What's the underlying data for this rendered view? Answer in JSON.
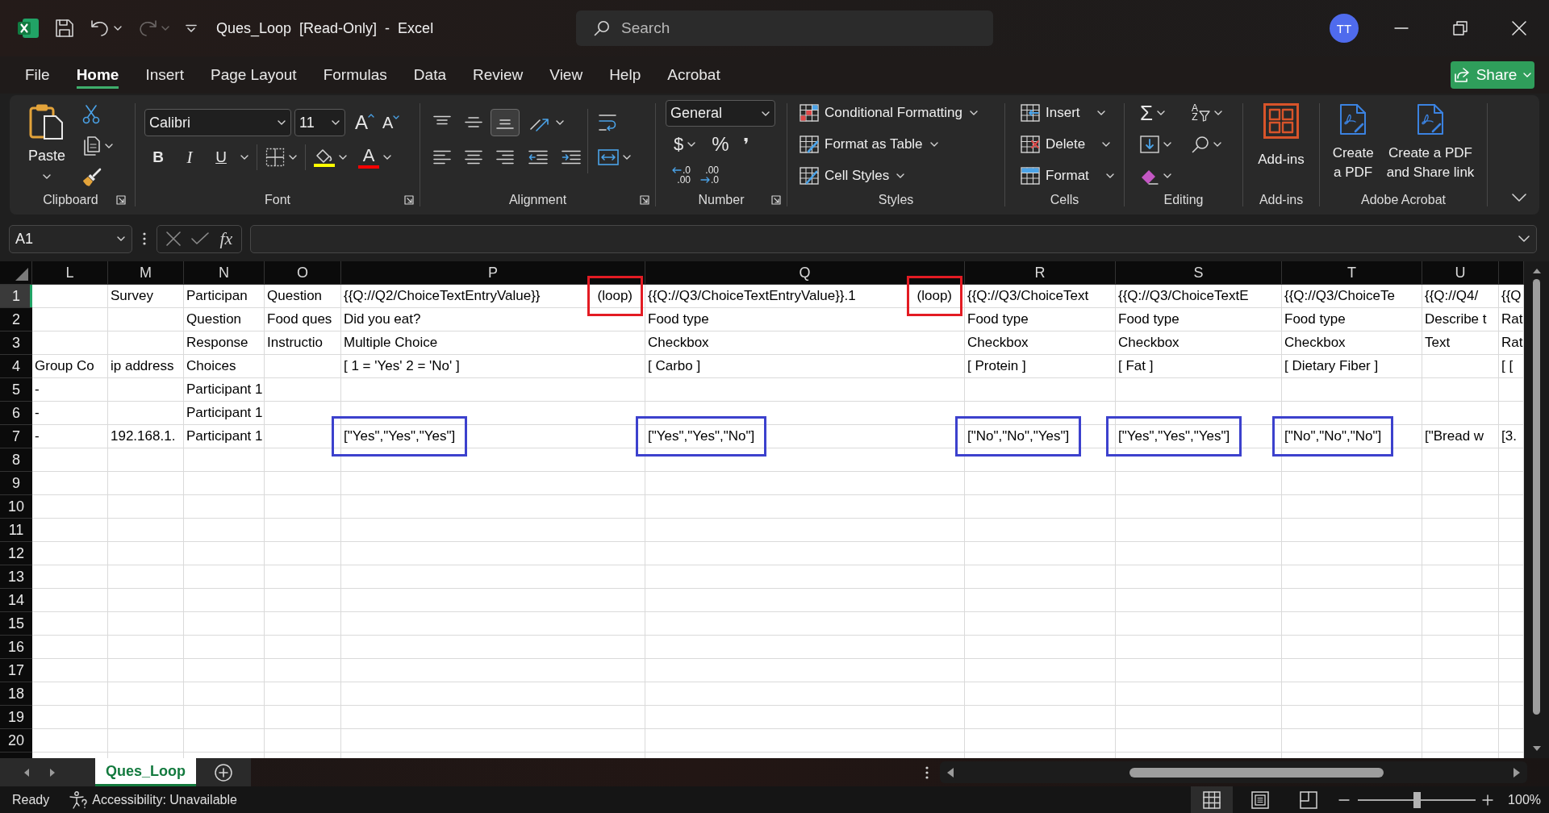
{
  "window": {
    "title": "Ques_Loop [Read-Only] - Excel",
    "search": {
      "placeholder": "Search"
    },
    "account": {
      "initials": "TT"
    }
  },
  "quick_access": [
    {
      "kind": "save",
      "disabled": false,
      "dropdown": false
    },
    {
      "kind": "undo",
      "disabled": false,
      "dropdown": true
    },
    {
      "kind": "redo",
      "disabled": true,
      "dropdown": true
    },
    {
      "kind": "customize",
      "disabled": false,
      "dropdown": false
    }
  ],
  "menu_tabs": [
    {
      "label": "File",
      "selected": false
    },
    {
      "label": "Home",
      "selected": true
    },
    {
      "label": "Insert",
      "selected": false
    },
    {
      "label": "Page Layout",
      "selected": false
    },
    {
      "label": "Formulas",
      "selected": false
    },
    {
      "label": "Data",
      "selected": false
    },
    {
      "label": "Review",
      "selected": false
    },
    {
      "label": "View",
      "selected": false
    },
    {
      "label": "Help",
      "selected": false
    },
    {
      "label": "Acrobat",
      "selected": false
    }
  ],
  "share_button": {
    "label": "Share"
  },
  "ribbon": {
    "clipboard": {
      "label": "Clipboard",
      "paste": "Paste"
    },
    "font": {
      "label": "Font",
      "face": "Calibri",
      "size": "11",
      "grow": "A",
      "shrink": "A",
      "bold": "B",
      "italic": "I",
      "underline": "U",
      "font_color": "A"
    },
    "alignment": {
      "label": "Alignment",
      "vertical": [
        {
          "kind": "top",
          "selected": false
        },
        {
          "kind": "middle",
          "selected": false
        },
        {
          "kind": "bottom",
          "selected": true
        }
      ],
      "horizontal": [
        {
          "kind": "left",
          "selected": false
        },
        {
          "kind": "center",
          "selected": false
        },
        {
          "kind": "right",
          "selected": false
        }
      ]
    },
    "number": {
      "label": "Number",
      "format": "General",
      "currency": "$",
      "percent": "%",
      "comma": "❜",
      "decimals": [
        {
          "kind": "increase",
          "top": ".0",
          "bottom": ".00"
        },
        {
          "kind": "decrease",
          "top": ".00",
          "bottom": ".0"
        }
      ]
    },
    "styles": {
      "label": "Styles",
      "items": [
        {
          "kind": "conditional",
          "label": "Conditional Formatting"
        },
        {
          "kind": "table",
          "label": "Format as Table"
        },
        {
          "kind": "cell_styles",
          "label": "Cell Styles"
        }
      ]
    },
    "cells": {
      "label": "Cells",
      "items": [
        {
          "kind": "insert",
          "label": "Insert"
        },
        {
          "kind": "delete",
          "label": "Delete"
        },
        {
          "kind": "format",
          "label": "Format"
        }
      ]
    },
    "editing": {
      "label": "Editing",
      "sum": "Σ",
      "sort": [
        "A",
        "Z"
      ]
    },
    "addins": {
      "label": "Add-ins",
      "button": "Add-ins"
    },
    "acrobat": {
      "label": "Adobe Acrobat",
      "buttons": [
        "Create\na PDF",
        "Create a PDF\nand Share link"
      ]
    }
  },
  "formula_bar": {
    "name_box": "A1",
    "function_button": "fx"
  },
  "sheet": {
    "columns": [
      "L",
      "M",
      "N",
      "O",
      "P",
      "Q",
      "R",
      "S",
      "T",
      "U"
    ],
    "rows": [
      {
        "number": "1",
        "selected": true,
        "cells": [
          null,
          "Survey",
          "Participan",
          "Question",
          {
            "text": "{{Q://Q2/ChoiceTextEntryValue}}",
            "tag": {
              "text": "(loop)",
              "color": "#e31b23"
            }
          },
          {
            "text": "{{Q://Q3/ChoiceTextEntryValue}}.1",
            "tag": {
              "text": "(loop)",
              "color": "#e31b23"
            }
          },
          "{{Q://Q3/ChoiceText",
          "{{Q://Q3/ChoiceTextE",
          "{{Q://Q3/ChoiceTe",
          "{{Q://Q4/",
          "{{Q"
        ]
      },
      {
        "number": "2",
        "selected": false,
        "cells": [
          null,
          null,
          "Question",
          "Food ques",
          "Did you eat?",
          "Food type",
          "Food type",
          "Food type",
          "Food type",
          "Describe t",
          "Rat"
        ]
      },
      {
        "number": "3",
        "selected": false,
        "cells": [
          null,
          null,
          "Response",
          "Instructio",
          "Multiple Choice",
          "Checkbox",
          "Checkbox",
          "Checkbox",
          "Checkbox",
          "Text",
          "Rat"
        ]
      },
      {
        "number": "4",
        "selected": false,
        "cells": [
          "Group Co",
          "ip address",
          "Choices",
          null,
          "[ 1 = 'Yes' 2 = 'No' ]",
          "[ Carbo ]",
          "[ Protein ]",
          "[ Fat ]",
          "[ Dietary Fiber ]",
          null,
          "[ ["
        ]
      },
      {
        "number": "5",
        "selected": false,
        "cells": [
          "-",
          null,
          "Participant 1"
        ]
      },
      {
        "number": "6",
        "selected": false,
        "cells": [
          "-",
          null,
          "Participant 1"
        ]
      },
      {
        "number": "7",
        "selected": false,
        "cells": [
          "-",
          "192.168.1.",
          "Participant 1",
          null,
          {
            "text": "[\"Yes\",\"Yes\",\"Yes\"]",
            "color": "#3c41cd"
          },
          {
            "text": "[\"Yes\",\"Yes\",\"No\"]",
            "color": "#3c41cd"
          },
          {
            "text": "[\"No\",\"No\",\"Yes\"]",
            "color": "#3c41cd"
          },
          {
            "text": "[\"Yes\",\"Yes\",\"Yes\"]",
            "color": "#3c41cd"
          },
          {
            "text": "[\"No\",\"No\",\"No\"]",
            "color": "#3c41cd"
          },
          "[\"Bread w",
          "[3."
        ]
      },
      {
        "number": "8",
        "selected": false
      },
      {
        "number": "9",
        "selected": false
      },
      {
        "number": "10",
        "selected": false
      },
      {
        "number": "11",
        "selected": false
      },
      {
        "number": "12",
        "selected": false
      },
      {
        "number": "13",
        "selected": false
      },
      {
        "number": "14",
        "selected": false
      },
      {
        "number": "15",
        "selected": false
      },
      {
        "number": "16",
        "selected": false
      },
      {
        "number": "17",
        "selected": false
      },
      {
        "number": "18",
        "selected": false
      },
      {
        "number": "19",
        "selected": false
      },
      {
        "number": "20",
        "selected": false
      }
    ]
  },
  "sheet_tabs": [
    {
      "label": "Ques_Loop",
      "selected": true
    }
  ],
  "status_bar": {
    "mode": "Ready",
    "accessibility": "Accessibility: Unavailable",
    "views": [
      {
        "kind": "normal",
        "selected": true
      },
      {
        "kind": "page_layout",
        "selected": false
      },
      {
        "kind": "page_break",
        "selected": false
      }
    ],
    "zoom": {
      "level": 0.5,
      "reading": "100%"
    }
  }
}
